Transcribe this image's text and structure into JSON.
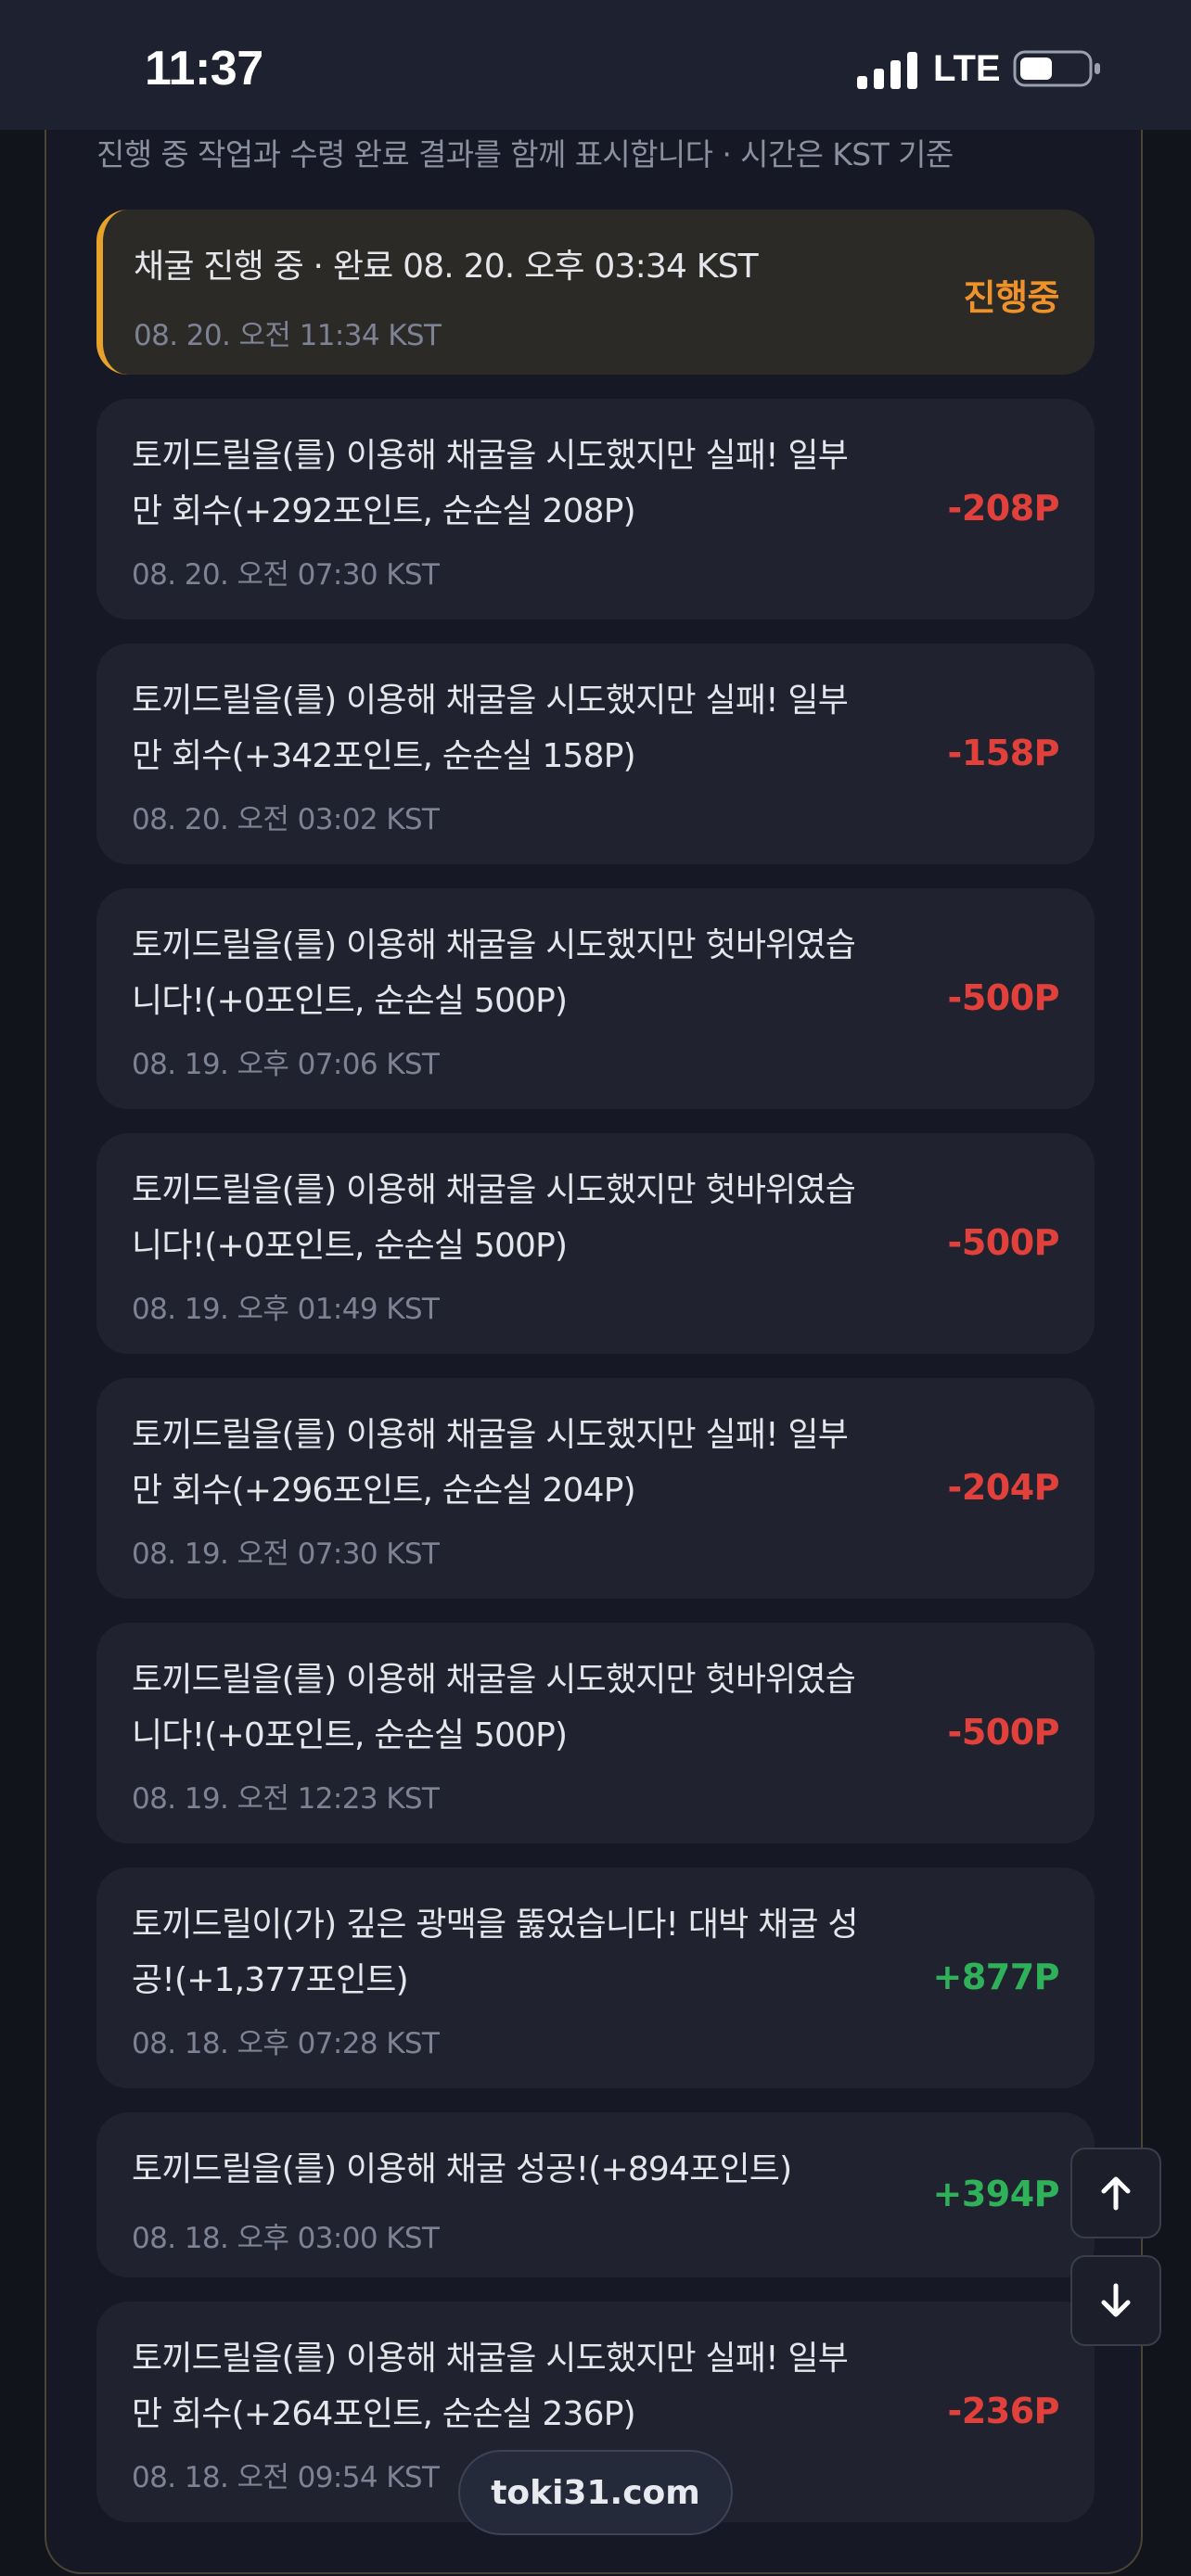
{
  "status_bar": {
    "time": "11:37",
    "network": "LTE",
    "icons": [
      "cellular-signal-icon",
      "battery-icon"
    ]
  },
  "header": {
    "subtitle": "진행 중 작업과 수령 완료 결과를 함께 표시합니다 · 시간은 KST 기준"
  },
  "colors": {
    "accent_orange": "#e6a22a",
    "loss_red": "#e2413b",
    "gain_green": "#2fb15a",
    "in_progress": "#f0922a"
  },
  "active_job": {
    "title": "채굴 진행 중 · 완료 08. 20. 오후 03:34 KST",
    "time": "08. 20. 오전 11:34 KST",
    "status": "진행중"
  },
  "log": [
    {
      "line1": "토끼드릴을(를) 이용해 채굴을 시도했지만 실패! 일부",
      "line2": "만 회수(+292포인트, 순손실 208P)",
      "time": "08. 20. 오전 07:30 KST",
      "amount": "-208P"
    },
    {
      "line1": "토끼드릴을(를) 이용해 채굴을 시도했지만 실패! 일부",
      "line2": "만 회수(+342포인트, 순손실 158P)",
      "time": "08. 20. 오전 03:02 KST",
      "amount": "-158P"
    },
    {
      "line1": "토끼드릴을(를) 이용해 채굴을 시도했지만 헛바위였습",
      "line2": "니다!(+0포인트, 순손실 500P)",
      "time": "08. 19. 오후 07:06 KST",
      "amount": "-500P"
    },
    {
      "line1": "토끼드릴을(를) 이용해 채굴을 시도했지만 헛바위였습",
      "line2": "니다!(+0포인트, 순손실 500P)",
      "time": "08. 19. 오후 01:49 KST",
      "amount": "-500P"
    },
    {
      "line1": "토끼드릴을(를) 이용해 채굴을 시도했지만 실패! 일부",
      "line2": "만 회수(+296포인트, 순손실 204P)",
      "time": "08. 19. 오전 07:30 KST",
      "amount": "-204P"
    },
    {
      "line1": "토끼드릴을(를) 이용해 채굴을 시도했지만 헛바위였습",
      "line2": "니다!(+0포인트, 순손실 500P)",
      "time": "08. 19. 오전 12:23 KST",
      "amount": "-500P"
    },
    {
      "line1": "토끼드릴이(가) 깊은 광맥을 뚫었습니다! 대박 채굴 성",
      "line2": "공!(+1,377포인트)",
      "time": "08. 18. 오후 07:28 KST",
      "amount": "+877P"
    },
    {
      "line1": "토끼드릴을(를) 이용해 채굴 성공!(+894포인트)",
      "line2": "",
      "time": "08. 18. 오후 03:00 KST",
      "amount": "+394P"
    },
    {
      "line1": "토끼드릴을(를) 이용해 채굴을 시도했지만 실패! 일부",
      "line2": "만 회수(+264포인트, 순손실 236P)",
      "time": "08. 18. 오전 09:54 KST",
      "amount": "-236P"
    }
  ],
  "footer": {
    "domain": "toki31.com"
  },
  "scroll_buttons": {
    "up_icon": "arrow-up-icon",
    "down_icon": "arrow-down-icon"
  }
}
